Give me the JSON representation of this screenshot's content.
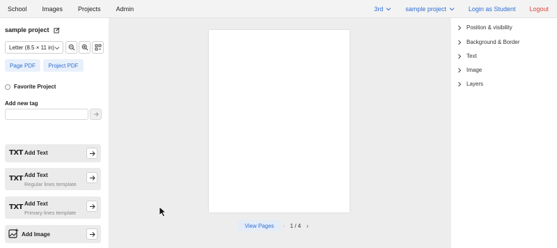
{
  "nav": {
    "items": [
      "School",
      "Images",
      "Projects",
      "Admin"
    ],
    "grade": "3rd",
    "project": "sample project",
    "login": "Login as Student",
    "logout": "Logout"
  },
  "sidebar": {
    "project_name": "sample project",
    "paper_size": "Letter (8.5 × 11 in)",
    "page_pdf": "Page PDF",
    "project_pdf": "Project PDF",
    "favorite_label": "Favorite Project",
    "tag_label": "Add new tag",
    "tag_placeholder": "",
    "tools": [
      {
        "icon": "TXT",
        "label": "Add Text",
        "sub": ""
      },
      {
        "icon": "TXT",
        "label": "Add Text",
        "sub": "Regular lines template"
      },
      {
        "icon": "TXT",
        "label": "Add Text",
        "sub": "Primary lines template"
      },
      {
        "icon": "image-add-icon",
        "label": "Add Image",
        "sub": ""
      }
    ]
  },
  "canvas": {
    "view_pages": "View Pages",
    "page_indicator": "1 / 4"
  },
  "properties": {
    "sections": [
      "Position & visibility",
      "Background & Border",
      "Text",
      "Image",
      "Layers"
    ]
  },
  "colors": {
    "accent": "#2f6fd6",
    "logout": "#e0443a"
  }
}
